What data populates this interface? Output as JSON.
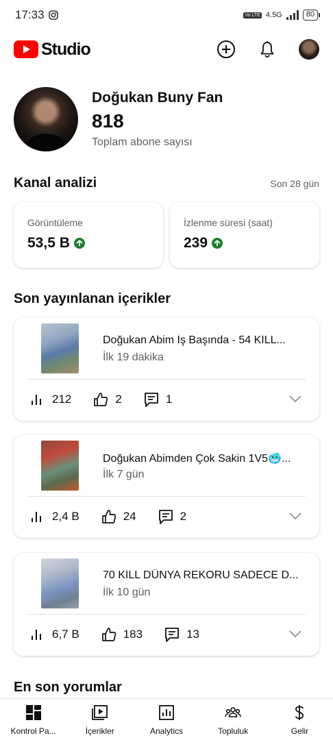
{
  "status_bar": {
    "time": "17:33",
    "network": "4.5G",
    "volte": "Vo LTE",
    "battery": "80"
  },
  "app_bar": {
    "logo_text": "Studio"
  },
  "channel": {
    "name": "Doğukan Buny Fan",
    "subscriber_count": "818",
    "subscriber_label": "Toplam abone sayısı"
  },
  "analytics": {
    "title": "Kanal analizi",
    "period": "Son 28 gün",
    "metrics": [
      {
        "label": "Görüntüleme",
        "value": "53,5 B",
        "trend": "up"
      },
      {
        "label": "İzlenme süresi (saat)",
        "value": "239",
        "trend": "up"
      }
    ]
  },
  "recent_content": {
    "title": "Son yayınlanan içerikler",
    "items": [
      {
        "title": "Doğukan Abim İş Başında - 54 KİLL...",
        "age": "İlk 19 dakika",
        "views": "212",
        "likes": "2",
        "comments": "1"
      },
      {
        "title": "Doğukan Abimden Çok Sakin 1V5🥶...",
        "age": "İlk 7 gün",
        "views": "2,4 B",
        "likes": "24",
        "comments": "2"
      },
      {
        "title": "70 KİLL DÜNYA REKORU SADECE D...",
        "age": "İlk 10 gün",
        "views": "6,7 B",
        "likes": "183",
        "comments": "13"
      }
    ]
  },
  "latest_comments": {
    "title": "En son yorumlar"
  },
  "bottom_nav": [
    {
      "label": "Kontrol Pa...",
      "icon": "dashboard-icon"
    },
    {
      "label": "İçerikler",
      "icon": "content-icon"
    },
    {
      "label": "Analytics",
      "icon": "analytics-icon"
    },
    {
      "label": "Topluluk",
      "icon": "community-icon"
    },
    {
      "label": "Gelir",
      "icon": "earn-icon"
    }
  ],
  "colors": {
    "brand_red": "#ff0000",
    "trend_green": "#1b7f2a",
    "secondary_text": "#606060"
  }
}
